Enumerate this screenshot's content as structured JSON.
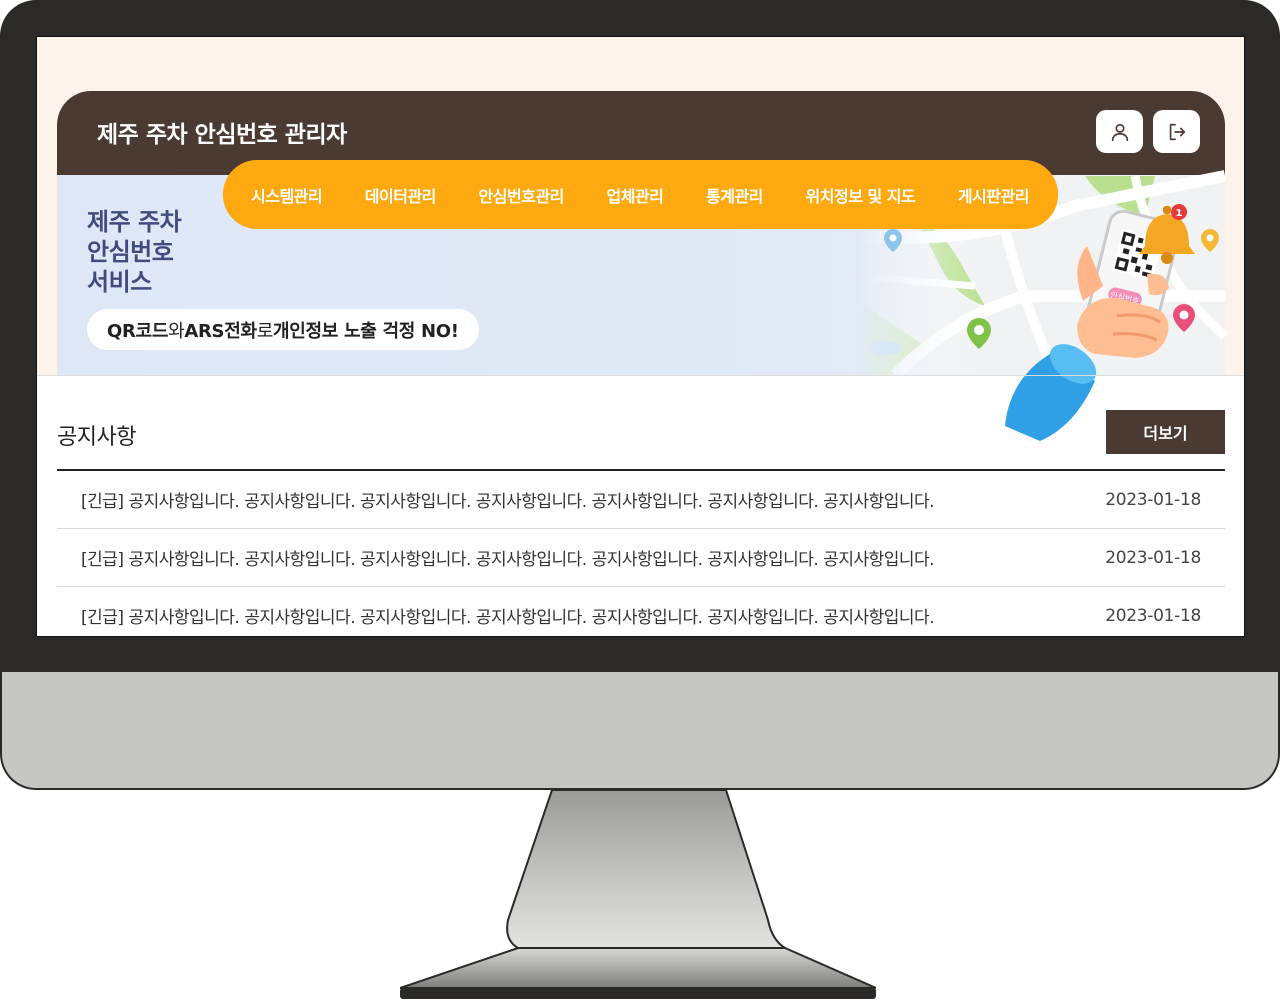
{
  "header": {
    "title": "제주 주차 안심번호 관리자"
  },
  "actions": {
    "profile_icon": "user-icon",
    "logout_icon": "logout-icon"
  },
  "nav": {
    "items": [
      {
        "label": "시스템관리"
      },
      {
        "label": "데이터관리"
      },
      {
        "label": "안심번호관리"
      },
      {
        "label": "업체관리"
      },
      {
        "label": "통계관리"
      },
      {
        "label": "위치정보 및 지도"
      },
      {
        "label": "게시판관리"
      }
    ]
  },
  "banner": {
    "title_lines": [
      "제주 주차",
      "안심번호",
      "서비스"
    ],
    "pill": {
      "part1": "QR코드",
      "part2": "와 ",
      "part3": "ARS전화",
      "part4": "로 ",
      "part5": "개인정보 노출 걱정 NO!"
    },
    "phone_label": "안심번호",
    "bell_badge": "1"
  },
  "notice": {
    "title": "공지사항",
    "more_label": "더보기",
    "rows": [
      {
        "text": "[긴급] 공지사항입니다. 공지사항입니다. 공지사항입니다. 공지사항입니다. 공지사항입니다. 공지사항입니다. 공지사항입니다.",
        "date": "2023-01-18"
      },
      {
        "text": "[긴급] 공지사항입니다. 공지사항입니다. 공지사항입니다. 공지사항입니다. 공지사항입니다. 공지사항입니다. 공지사항입니다.",
        "date": "2023-01-18"
      },
      {
        "text": "[긴급] 공지사항입니다. 공지사항입니다. 공지사항입니다. 공지사항입니다. 공지사항입니다. 공지사항입니다. 공지사항입니다.",
        "date": "2023-01-18"
      }
    ]
  },
  "colors": {
    "brown": "#4a3a32",
    "orange": "#fea90f",
    "banner_text": "#3f4c7d",
    "bezel": "#2b2a28",
    "stand": "#c5c6c4"
  }
}
